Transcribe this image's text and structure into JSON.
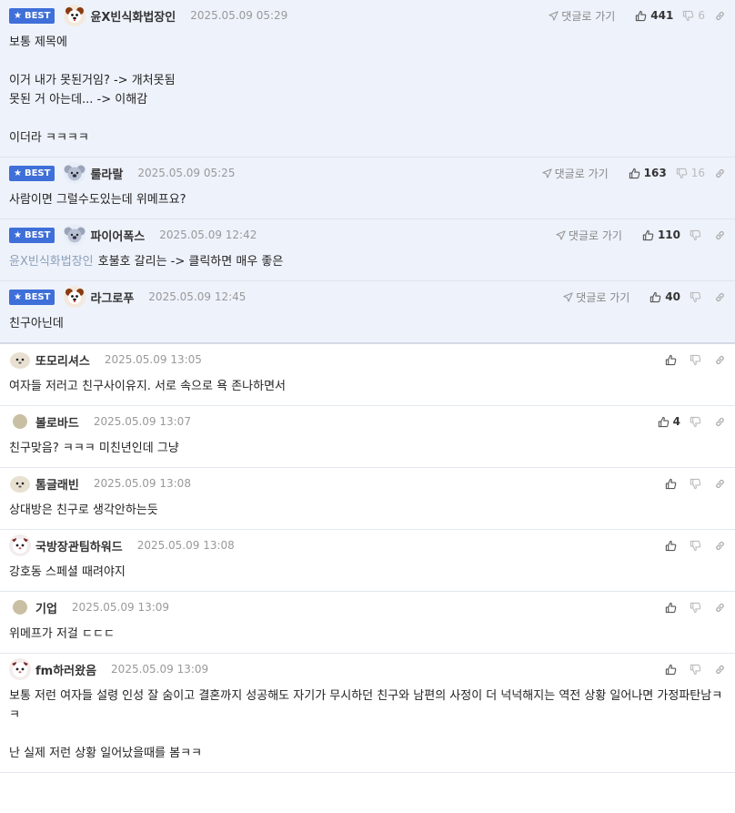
{
  "labels": {
    "best": "BEST",
    "go_reply": "댓글로 가기"
  },
  "colors": {
    "best_badge": "#3f6fd8",
    "best_bg": "#eef2fb"
  },
  "comments": [
    {
      "nick": "윤X빈식화법장인",
      "date": "2025.05.09 05:29",
      "best": true,
      "up": "441",
      "down": "6",
      "body": "보통 제목에\n\n이거 내가 못된거임? -> 개처못됨\n못된 거 아는데... -> 이해감\n\n이더라 ㅋㅋㅋㅋ",
      "mention": "",
      "avatar": "dog"
    },
    {
      "nick": "룰라랄",
      "date": "2025.05.09 05:25",
      "best": true,
      "up": "163",
      "down": "16",
      "body": "사람이면 그럴수도있는데 위메프요?",
      "mention": "",
      "avatar": "koala"
    },
    {
      "nick": "파이어폭스",
      "date": "2025.05.09 12:42",
      "best": true,
      "up": "110",
      "down": "",
      "body": "호불호 갈리는 -> 클릭하면 매우 좋은",
      "mention": "윤X빈식화법장인",
      "avatar": "koala"
    },
    {
      "nick": "라그로푸",
      "date": "2025.05.09 12:45",
      "best": true,
      "up": "40",
      "down": "",
      "body": "친구아닌데",
      "mention": "",
      "avatar": "dog"
    },
    {
      "nick": "또모리셔스",
      "date": "2025.05.09 13:05",
      "best": false,
      "up": "",
      "down": "",
      "body": "여자들 저러고 친구사이유지. 서로 속으로 욕 존나하면서",
      "mention": "",
      "avatar": "blob"
    },
    {
      "nick": "볼로바드",
      "date": "2025.05.09 13:07",
      "best": false,
      "up": "4",
      "down": "",
      "body": "친구맞음? ㅋㅋㅋ 미친년인데 그냥",
      "mention": "",
      "avatar": "dot"
    },
    {
      "nick": "톰글래빈",
      "date": "2025.05.09 13:08",
      "best": false,
      "up": "",
      "down": "",
      "body": "상대방은 친구로 생각안하는듯",
      "mention": "",
      "avatar": "blob"
    },
    {
      "nick": "국방장관팀하워드",
      "date": "2025.05.09 13:08",
      "best": false,
      "up": "",
      "down": "",
      "body": "강호동 스페셜 때려야지",
      "mention": "",
      "avatar": "cat"
    },
    {
      "nick": "기업",
      "date": "2025.05.09 13:09",
      "best": false,
      "up": "",
      "down": "",
      "body": "위메프가 저걸 ㄷㄷㄷ",
      "mention": "",
      "avatar": "dot"
    },
    {
      "nick": "fm하러왔음",
      "date": "2025.05.09 13:09",
      "best": false,
      "up": "",
      "down": "",
      "body": "보통 저런 여자들 설령 인성 잘 숨이고 결혼까지 성공해도 자기가 무시하던 친구와 남편의 사정이 더 넉넉해지는 역전 상황 일어나면 가정파탄남ㅋㅋ\n\n난 실제 저런 상황 일어났을때를 봄ㅋㅋ",
      "mention": "",
      "avatar": "cat"
    }
  ]
}
